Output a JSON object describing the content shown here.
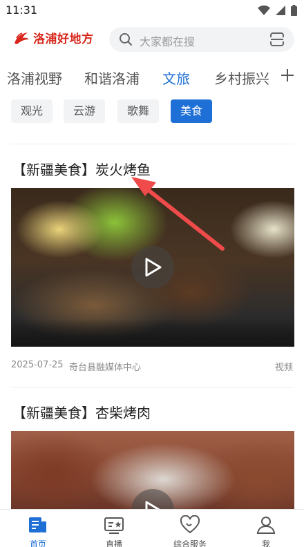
{
  "status_bar": {
    "time": "11:31"
  },
  "header": {
    "logo_text": "洛浦好地方",
    "search_placeholder": "大家都在搜"
  },
  "channels": [
    {
      "label": "洛浦视野"
    },
    {
      "label": "和谐洛浦"
    },
    {
      "label": "文旅",
      "active": true
    },
    {
      "label": "乡村振兴"
    }
  ],
  "sub_tabs": [
    {
      "label": "观光"
    },
    {
      "label": "云游"
    },
    {
      "label": "歌舞"
    },
    {
      "label": "美食",
      "active": true
    }
  ],
  "articles": [
    {
      "title": "【新疆美食】炭火烤鱼",
      "date": "2025-07-25",
      "source": "奇台县融媒体中心",
      "type": "视频"
    },
    {
      "title": "【新疆美食】杏柴烤肉"
    }
  ],
  "bottom_nav": [
    {
      "label": "首页",
      "icon": "home-news-icon",
      "active": true
    },
    {
      "label": "直播",
      "icon": "live-tv-icon"
    },
    {
      "label": "综合服务",
      "icon": "heart-service-icon"
    },
    {
      "label": "我",
      "icon": "user-icon"
    }
  ],
  "colors": {
    "accent": "#1e6fd6",
    "brand": "#d8271c",
    "annotation_arrow": "#ef4b4b"
  }
}
